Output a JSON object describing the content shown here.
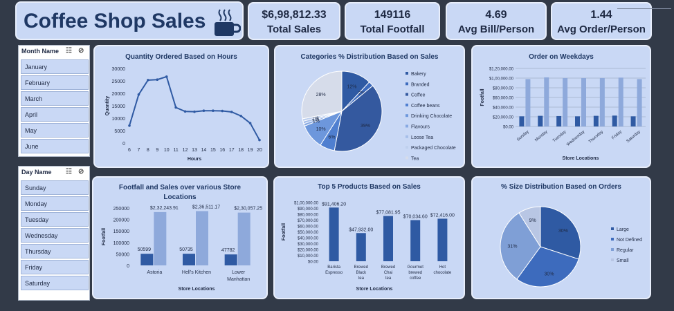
{
  "header": {
    "title": "Coffee Shop Sales",
    "icon": "coffee-cup-icon"
  },
  "kpis": [
    {
      "value": "$6,98,812.33",
      "label": "Total Sales"
    },
    {
      "value": "149116",
      "label": "Total Footfall"
    },
    {
      "value": "4.69",
      "label": "Avg Bill/Person"
    },
    {
      "value": "1.44",
      "label": "Avg Order/Person"
    }
  ],
  "month_slicer": {
    "title": "Month Name",
    "items": [
      "January",
      "February",
      "March",
      "April",
      "May",
      "June"
    ]
  },
  "day_slicer": {
    "title": "Day Name",
    "items": [
      "Sunday",
      "Monday",
      "Tuesday",
      "Wednesday",
      "Thursday",
      "Friday",
      "Saturday"
    ]
  },
  "colors": {
    "primary": "#2f5aa3",
    "light": "#8ea9db",
    "panel": "#c9d8f5",
    "background": "#323a48"
  },
  "chart_data": [
    {
      "type": "line",
      "title": "Quantity Ordered Based on Hours",
      "xlabel": "Hours",
      "ylabel": "Quantity",
      "x": [
        6,
        7,
        8,
        9,
        10,
        11,
        12,
        13,
        14,
        15,
        16,
        17,
        18,
        19,
        20
      ],
      "values": [
        7000,
        19500,
        25300,
        25500,
        26700,
        14300,
        12700,
        12600,
        13000,
        13000,
        12900,
        12500,
        10900,
        8000,
        1200
      ],
      "yticks": [
        "0",
        "5000",
        "10000",
        "15000",
        "20000",
        "25000",
        "30000"
      ],
      "ylim": [
        0,
        30000
      ]
    },
    {
      "type": "pie",
      "title": "Categories % Distribution Based on Sales",
      "categories": [
        "Bakery",
        "Branded",
        "Coffee",
        "Coffee beans",
        "Drinking Chocolate",
        "Flavours",
        "Loose Tea",
        "Packaged Chocolate",
        "Tea"
      ],
      "values": [
        12,
        2,
        39,
        6,
        10,
        1,
        1,
        1,
        28
      ],
      "labels": [
        "12%",
        "2%",
        "39%",
        "6%",
        "10%",
        "1%",
        "1%",
        "1%",
        "28%"
      ]
    },
    {
      "type": "bar",
      "title": "Order on Weekdays",
      "xlabel": "Store Locations",
      "ylabel": "Footfall",
      "categories": [
        "Sunday",
        "Monday",
        "Tuesday",
        "Wednesday",
        "Thursday",
        "Friday",
        "Saturday"
      ],
      "series": [
        {
          "values": [
            21000,
            22000,
            21500,
            21000,
            22000,
            22500,
            21000
          ]
        },
        {
          "values": [
            98000,
            101500,
            100000,
            100000,
            100000,
            101000,
            98000
          ]
        }
      ],
      "yticks": [
        "$0.00",
        "$20,000.00",
        "$40,000.00",
        "$60,000.00",
        "$80,000.00",
        "$1,00,000.00",
        "$1,20,000.00"
      ],
      "ylim": [
        0,
        120000
      ]
    },
    {
      "type": "bar",
      "title": "Footfall and Sales over various Store Locations",
      "xlabel": "Store Locations",
      "ylabel": "Footfall",
      "categories": [
        "Astoria",
        "Hell's Kitchen",
        "Lower Manhattan"
      ],
      "series": [
        {
          "values": [
            50599,
            50735,
            47782
          ],
          "labels": [
            "50599",
            "50735",
            "47782"
          ]
        },
        {
          "values": [
            232243.91,
            236511.17,
            230057.25
          ],
          "labels": [
            "$2,32,243.91",
            "$2,36,511.17",
            "$2,30,057.25"
          ]
        }
      ],
      "yticks": [
        "0",
        "50000",
        "100000",
        "150000",
        "200000",
        "250000"
      ],
      "ylim": [
        0,
        250000
      ]
    },
    {
      "type": "bar",
      "title": "Top 5 Products Based on Sales",
      "xlabel": "Store Locations",
      "ylabel": "Footfall",
      "categories": [
        "Barista Espresso",
        "Brewed Black tea",
        "Brewed Chai tea",
        "Gourmet brewed coffee",
        "Hot chocolate"
      ],
      "values": [
        91406.2,
        47932.0,
        77081.95,
        70034.6,
        72416.0
      ],
      "labels": [
        "$91,406.20",
        "$47,932.00",
        "$77,081.95",
        "$70,034.60",
        "$72,416.00"
      ],
      "yticks": [
        "$0.00",
        "$10,000.00",
        "$20,000.00",
        "$30,000.00",
        "$40,000.00",
        "$50,000.00",
        "$60,000.00",
        "$70,000.00",
        "$80,000.00",
        "$90,000.00",
        "$1,00,000.00"
      ],
      "ylim": [
        0,
        100000
      ]
    },
    {
      "type": "pie",
      "title": "% Size Distribution Based on Orders",
      "categories": [
        "Large",
        "Not Defined",
        "Regular",
        "Small"
      ],
      "values": [
        30,
        30,
        31,
        9
      ],
      "labels": [
        "30%",
        "30%",
        "31%",
        "9%"
      ]
    }
  ]
}
